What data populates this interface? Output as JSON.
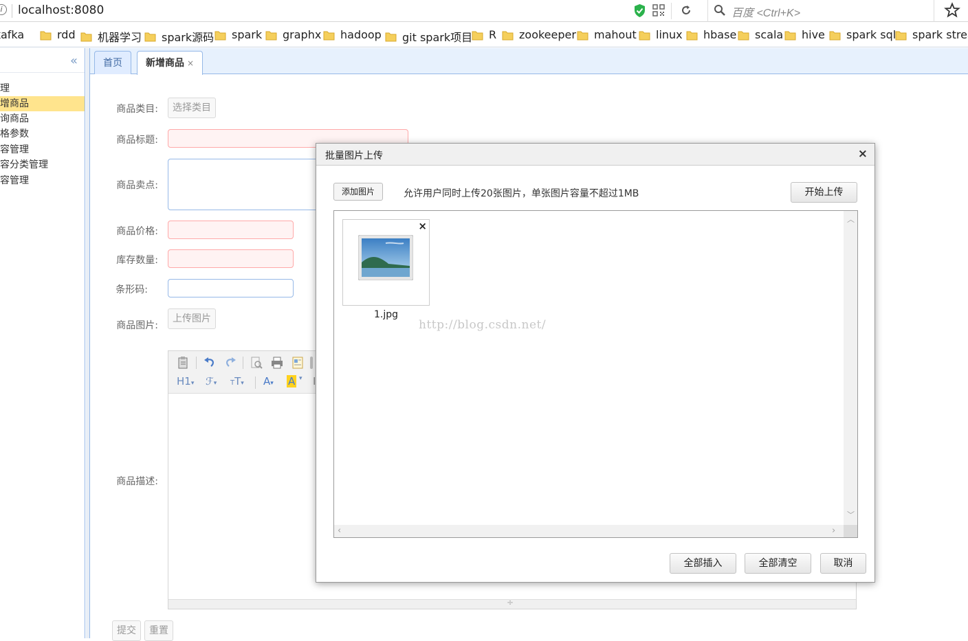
{
  "browser": {
    "url": "localhost:8080",
    "search_placeholder": "百度 <Ctrl+K>",
    "bookmarks": [
      "kafka",
      "rdd",
      "机器学习",
      "spark源码",
      "spark",
      "graphx",
      "hadoop",
      "git spark项目",
      "R",
      "zookeeper",
      "mahout",
      "linux",
      "hbase",
      "scala",
      "hive",
      "spark sql",
      "spark strea"
    ]
  },
  "sidebar": {
    "items": [
      "理",
      "增商品",
      "询商品",
      "格参数",
      "容管理",
      "容分类管理",
      "容管理"
    ],
    "active_index": 1
  },
  "tabs": [
    {
      "label": "首页"
    },
    {
      "label": "新增商品",
      "close": "×"
    }
  ],
  "form": {
    "category_label": "商品类目:",
    "category_button": "选择类目",
    "title_label": "商品标题:",
    "sell_point_label": "商品卖点:",
    "price_label": "商品价格:",
    "stock_label": "库存数量:",
    "barcode_label": "条形码:",
    "image_label": "商品图片:",
    "upload_button": "上传图片",
    "desc_label": "商品描述:",
    "submit_button": "提交",
    "reset_button": "重置"
  },
  "modal": {
    "title": "批量图片上传",
    "close": "×",
    "add_button": "添加图片",
    "hint": "允许用户同时上传20张图片，单张图片容量不超过1MB",
    "start_button": "开始上传",
    "images": [
      {
        "name": "1.jpg",
        "delete": "×"
      }
    ],
    "insert_all": "全部插入",
    "clear_all": "全部清空",
    "cancel": "取消"
  },
  "watermark": "http://blog.csdn.net/",
  "colors": {
    "accent_blue": "#95b8e7",
    "active_highlight": "#ffe48d",
    "invalid_field": "#ffa8a8"
  }
}
